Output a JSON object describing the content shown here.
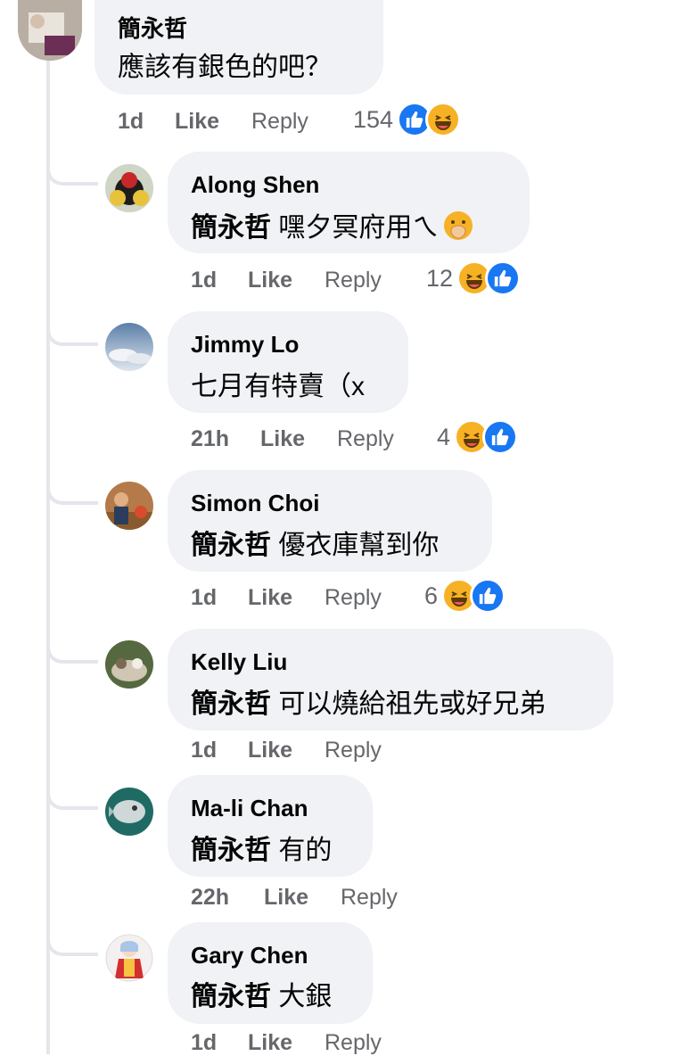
{
  "root": {
    "author": "簡永哲",
    "text": "應該有銀色的吧？",
    "time": "1d",
    "like": "Like",
    "reply": "Reply",
    "reaction_count": "154"
  },
  "replies": [
    {
      "author": "Along Shen",
      "mention": "簡永哲",
      "text": "嘿夕冥府用ㄟ",
      "time": "1d",
      "like": "Like",
      "reply": "Reply",
      "reaction_count": "12"
    },
    {
      "author": "Jimmy Lo",
      "mention": "",
      "text": "七月有特賣（x",
      "time": "21h",
      "like": "Like",
      "reply": "Reply",
      "reaction_count": "4"
    },
    {
      "author": "Simon Choi",
      "mention": "簡永哲",
      "text": "優衣庫幫到你",
      "time": "1d",
      "like": "Like",
      "reply": "Reply",
      "reaction_count": "6"
    },
    {
      "author": "Kelly Liu",
      "mention": "簡永哲",
      "text": "可以燒給祖先或好兄弟",
      "time": "1d",
      "like": "Like",
      "reply": "Reply"
    },
    {
      "author": "Ma-li Chan",
      "mention": "簡永哲",
      "text": "有的",
      "time": "22h",
      "like": "Like",
      "reply": "Reply"
    },
    {
      "author": "Gary Chen",
      "mention": "簡永哲",
      "text": "大銀",
      "time": "1d",
      "like": "Like",
      "reply": "Reply"
    }
  ],
  "colors": {
    "like": "#1877f2",
    "haha": "#f7b125",
    "bubble": "#f0f2f5",
    "meta": "#65676b"
  }
}
